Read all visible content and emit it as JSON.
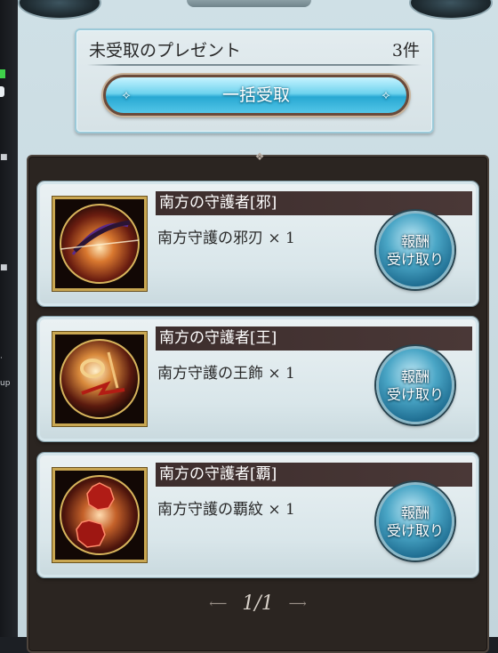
{
  "present_box": {
    "title": "未受取のプレゼント",
    "count": "3件",
    "bulk_claim_label": "一括受取"
  },
  "items": [
    {
      "category": "南方の守護者[邪]",
      "reward": "南方守護の邪刃 × 1",
      "claim_line1": "報酬",
      "claim_line2": "受け取り",
      "icon": "evil-blade-icon"
    },
    {
      "category": "南方の守護者[王]",
      "reward": "南方守護の王飾 × 1",
      "claim_line1": "報酬",
      "claim_line2": "受け取り",
      "icon": "king-ornament-icon"
    },
    {
      "category": "南方の守護者[覇]",
      "reward": "南方守護の覇紋 × 1",
      "claim_line1": "報酬",
      "claim_line2": "受け取り",
      "icon": "supremacy-crest-icon"
    }
  ],
  "pager": {
    "label": "1/1"
  },
  "left_strip": {
    "mark_label": "up"
  },
  "colors": {
    "accent": "#28a8d2",
    "frame": "#2b2521",
    "header": "#3d2e2d",
    "gold": "#c9a752"
  }
}
